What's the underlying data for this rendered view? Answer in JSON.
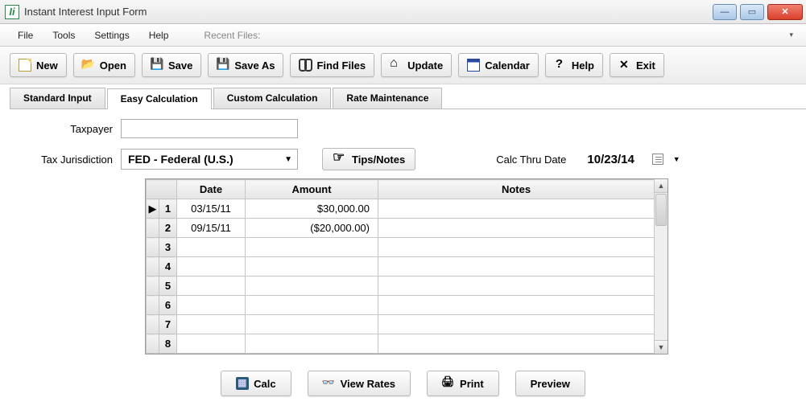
{
  "window": {
    "title": "Instant Interest Input Form"
  },
  "menu": {
    "file": "File",
    "tools": "Tools",
    "settings": "Settings",
    "help": "Help",
    "recent_label": "Recent Files:"
  },
  "toolbar": {
    "new": "New",
    "open": "Open",
    "save": "Save",
    "save_as": "Save As",
    "find_files": "Find Files",
    "update": "Update",
    "calendar": "Calendar",
    "help": "Help",
    "exit": "Exit"
  },
  "tabs": {
    "standard": "Standard Input",
    "easy": "Easy Calculation",
    "custom": "Custom Calculation",
    "rate": "Rate Maintenance"
  },
  "form": {
    "taxpayer_label": "Taxpayer",
    "taxpayer_value": "",
    "jurisdiction_label": "Tax Jurisdiction",
    "jurisdiction_value": "FED - Federal (U.S.)",
    "tips_label": "Tips/Notes",
    "calc_thru_label": "Calc Thru Date",
    "calc_thru_value": "10/23/14"
  },
  "grid": {
    "headers": {
      "date": "Date",
      "amount": "Amount",
      "notes": "Notes"
    },
    "rows": [
      {
        "n": "1",
        "date": "03/15/11",
        "amount": "$30,000.00",
        "notes": "",
        "current": true
      },
      {
        "n": "2",
        "date": "09/15/11",
        "amount": "($20,000.00)",
        "notes": ""
      },
      {
        "n": "3",
        "date": "",
        "amount": "",
        "notes": ""
      },
      {
        "n": "4",
        "date": "",
        "amount": "",
        "notes": ""
      },
      {
        "n": "5",
        "date": "",
        "amount": "",
        "notes": ""
      },
      {
        "n": "6",
        "date": "",
        "amount": "",
        "notes": ""
      },
      {
        "n": "7",
        "date": "",
        "amount": "",
        "notes": ""
      },
      {
        "n": "8",
        "date": "",
        "amount": "",
        "notes": ""
      }
    ]
  },
  "bottom": {
    "calc": "Calc",
    "view_rates": "View Rates",
    "print": "Print",
    "preview": "Preview"
  }
}
